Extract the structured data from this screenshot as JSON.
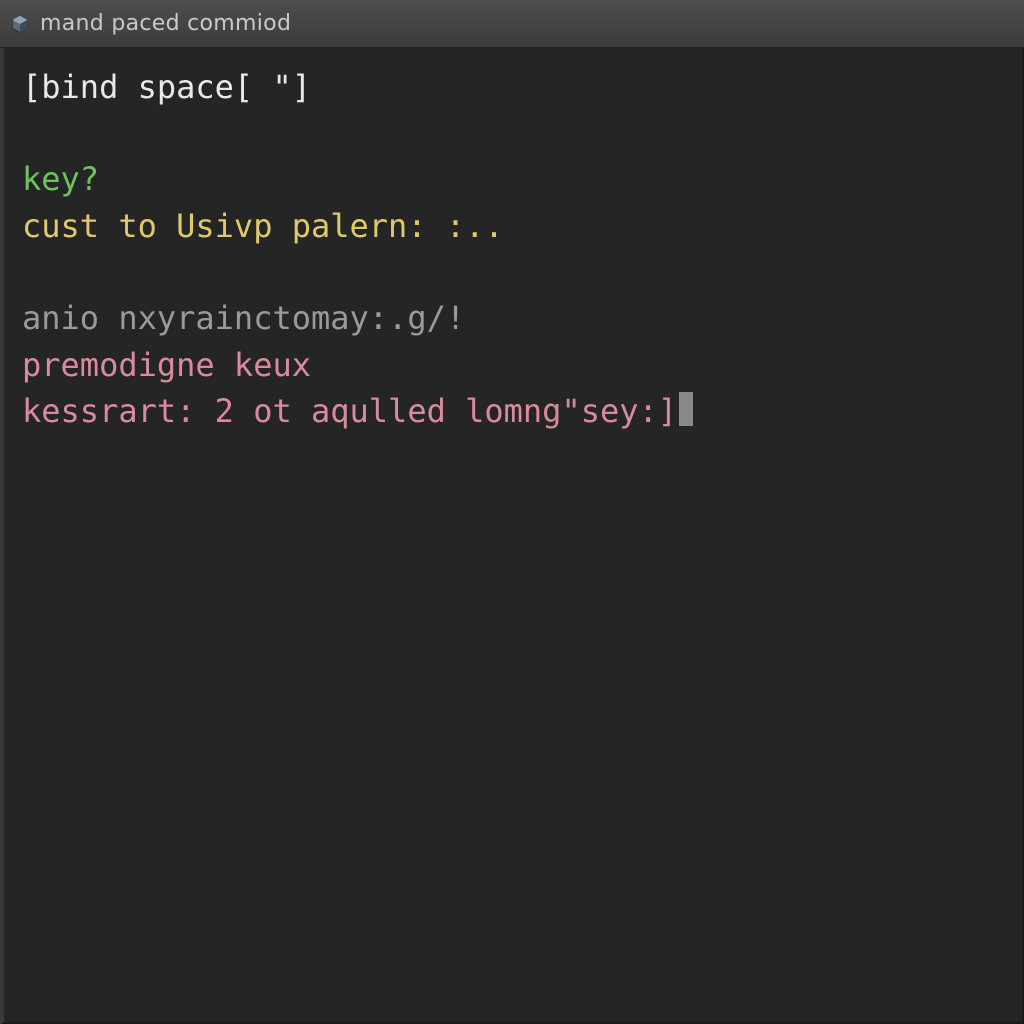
{
  "window": {
    "title": "mand paced commiod"
  },
  "terminal": {
    "lines": [
      {
        "cls": "c-white",
        "text": "[bind space[ \"]"
      },
      {
        "blank": true
      },
      {
        "cls": "c-green",
        "text": "key?"
      },
      {
        "cls": "c-yellow",
        "text": "cust to Usivp palern: :.."
      },
      {
        "blank": true
      },
      {
        "cls": "c-gray",
        "text": "anio nxyrainctomay:.g/!"
      },
      {
        "cls": "c-pink",
        "text": "premodigne keux"
      },
      {
        "cls": "c-pink",
        "text": "kessrart: 2 ot aqulled lomng\"sey:]",
        "cursor": true
      }
    ]
  },
  "colors": {
    "bg": "#252525",
    "titlebar": "#3c3c3c",
    "white": "#e8e8e8",
    "green": "#6ec35a",
    "yellow": "#e0c96a",
    "gray": "#9a9a9a",
    "pink": "#d98b9d"
  }
}
